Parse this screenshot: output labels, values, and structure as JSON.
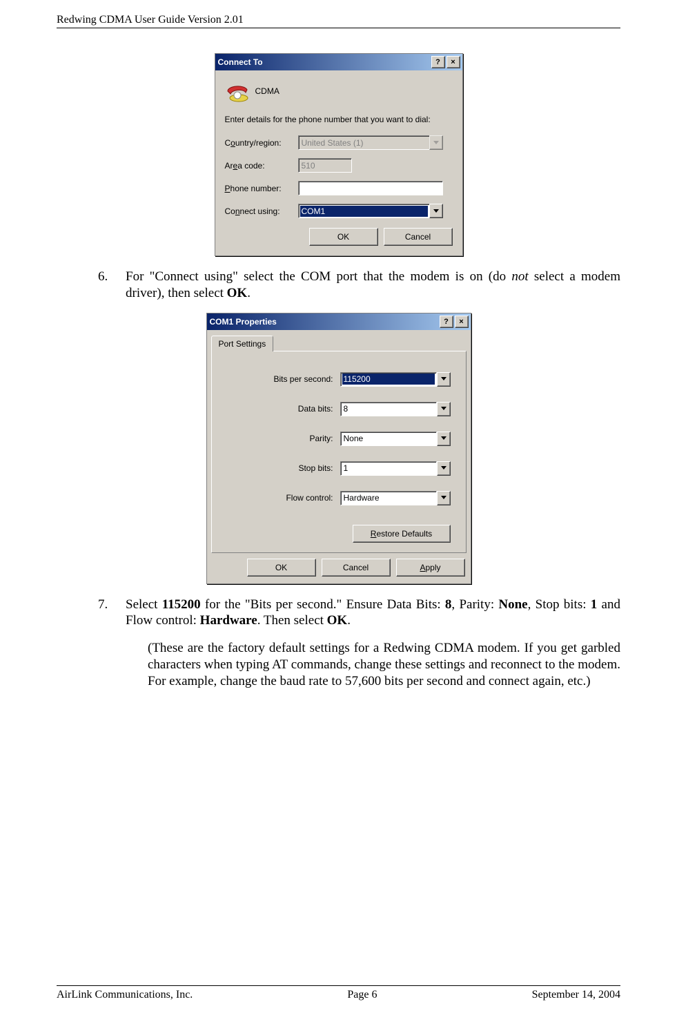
{
  "header": {
    "title": "Redwing CDMA User Guide Version 2.01"
  },
  "footer": {
    "left": "AirLink Communications, Inc.",
    "center": "Page 6",
    "right": "September 14, 2004"
  },
  "dialog1": {
    "title": "Connect To",
    "help_btn": "?",
    "close_btn": "×",
    "icon_label": "CDMA",
    "instruction": "Enter details for the phone number that you want to dial:",
    "fields": {
      "country": {
        "label_pre": "C",
        "label_ul": "o",
        "label_post": "untry/region:",
        "value": "United States (1)"
      },
      "area": {
        "label_pre": "Ar",
        "label_ul": "e",
        "label_post": "a code:",
        "value": "510"
      },
      "phone": {
        "label_ul": "P",
        "label_post": "hone number:",
        "value": ""
      },
      "connect": {
        "label_pre": "Co",
        "label_ul": "n",
        "label_post": "nect using:",
        "value": "COM1"
      }
    },
    "buttons": {
      "ok": "OK",
      "cancel": "Cancel"
    }
  },
  "step6": {
    "num": "6.",
    "pre": "For \"Connect using\" select the COM port that the modem is on (do ",
    "italic": "not",
    "mid": " select a modem driver), then select ",
    "bold": "OK",
    "post": "."
  },
  "dialog2": {
    "title": "COM1 Properties",
    "help_btn": "?",
    "close_btn": "×",
    "tab": "Port Settings",
    "fields": {
      "bits": {
        "label_ul": "B",
        "label_post": "its per second:",
        "value": "115200"
      },
      "data": {
        "label_ul": "D",
        "label_post": "ata bits:",
        "value": "8"
      },
      "parity": {
        "label_ul": "P",
        "label_post": "arity:",
        "value": "None"
      },
      "stop": {
        "label_ul": "S",
        "label_post": "top bits:",
        "value": "1"
      },
      "flow": {
        "label_ul": "F",
        "label_post": "low control:",
        "value": "Hardware"
      }
    },
    "restore": {
      "ul": "R",
      "post": "estore Defaults"
    },
    "buttons": {
      "ok": "OK",
      "cancel": "Cancel",
      "apply_ul": "A",
      "apply_post": "pply"
    }
  },
  "step7": {
    "num": "7.",
    "p1": "Select ",
    "b1": "115200",
    "p2": " for the \"Bits per second.\" Ensure Data Bits: ",
    "b2": "8",
    "p3": ", Parity: ",
    "b3": "None",
    "p4": ", Stop bits: ",
    "b4": "1",
    "p5": " and Flow control: ",
    "b5": "Hardware",
    "p6": ". Then select ",
    "b6": "OK",
    "p7": "."
  },
  "step7_paren": "(These are the factory default settings for a Redwing CDMA modem. If you get garbled characters when typing AT commands, change these settings and reconnect to the modem. For example, change the baud rate to 57,600 bits per second and connect again, etc.)"
}
